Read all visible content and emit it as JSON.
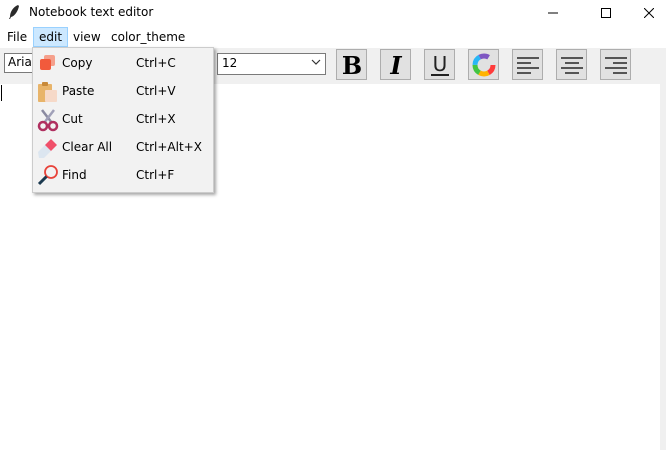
{
  "window": {
    "title": "Notebook text editor",
    "icon": "feather-icon"
  },
  "menubar": {
    "items": [
      "File",
      "edit",
      "view",
      "color_theme"
    ],
    "active": "edit"
  },
  "toolbar": {
    "font_family_value": "Arial",
    "font_size_value": "12",
    "buttons": [
      "bold",
      "italic",
      "underline",
      "color-picker",
      "align-left",
      "align-center",
      "align-right"
    ]
  },
  "edit_menu": {
    "items": [
      {
        "label": "Copy",
        "shortcut": "Ctrl+C",
        "icon": "copy-icon"
      },
      {
        "label": "Paste",
        "shortcut": "Ctrl+V",
        "icon": "paste-icon"
      },
      {
        "label": "Cut",
        "shortcut": "Ctrl+X",
        "icon": "scissors-icon"
      },
      {
        "label": "Clear All",
        "shortcut": "Ctrl+Alt+X",
        "icon": "eraser-icon"
      },
      {
        "label": "Find",
        "shortcut": "Ctrl+F",
        "icon": "magnifier-icon"
      }
    ]
  },
  "colors": {
    "menu_highlight": "#cce8ff",
    "toolbar_bg": "#f0f0f0",
    "menu_bg": "#f2f2f2"
  }
}
